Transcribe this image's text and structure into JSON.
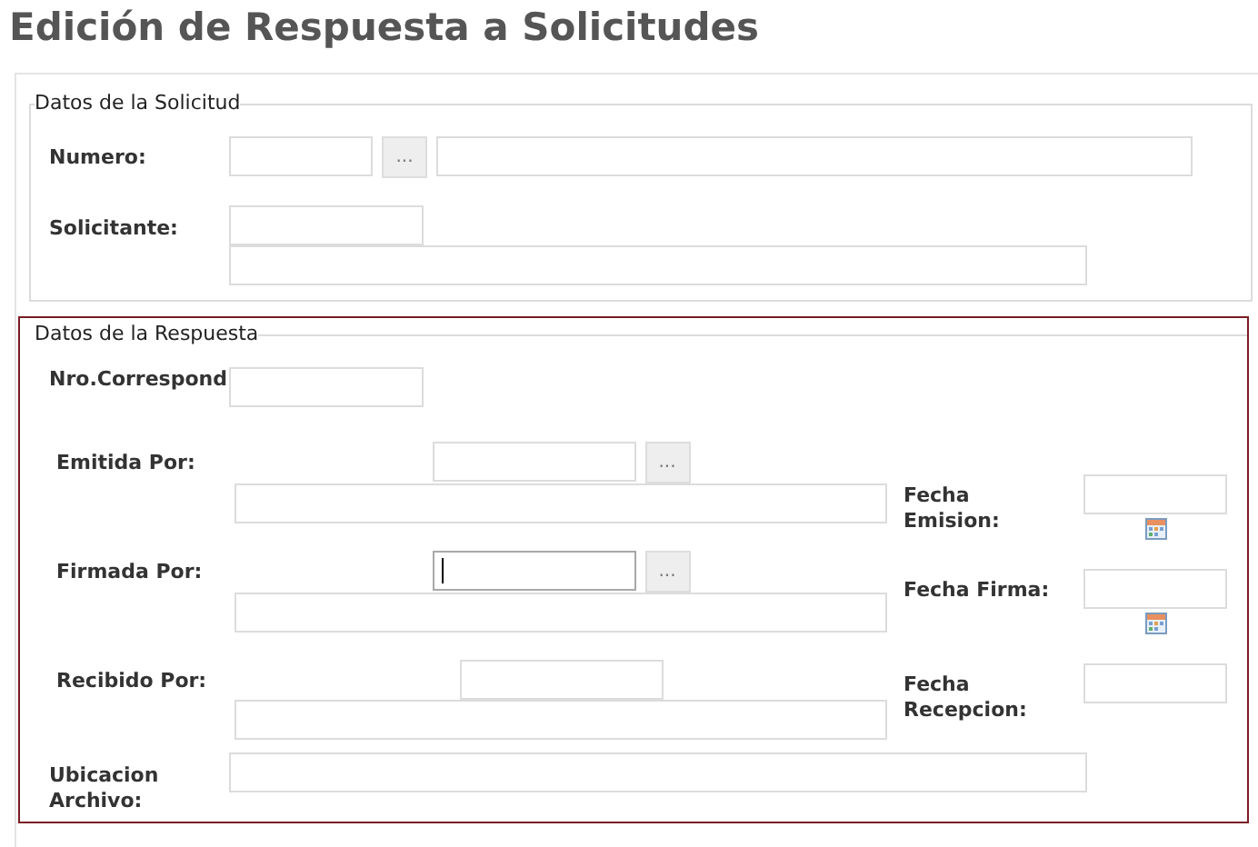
{
  "page_title": "Edición de Respuesta a Solicitudes",
  "solicitud": {
    "legend": "Datos de la Solicitud",
    "numero": {
      "label": "Numero:",
      "button": "..."
    },
    "solicitante": {
      "label": "Solicitante:"
    }
  },
  "respuesta": {
    "legend": "Datos de la Respuesta",
    "nro_correspond": {
      "label": "Nro.Correspond"
    },
    "persons": [
      {
        "label": "Emitida Por:",
        "button": "...",
        "focused": false
      },
      {
        "label": "Firmada Por:",
        "button": "...",
        "focused": true
      },
      {
        "label": "Recibido Por:",
        "focused": false
      }
    ],
    "dates": [
      {
        "label": "Fecha Emision:",
        "calendar": true
      },
      {
        "label": "Fecha Firma:",
        "calendar": true
      },
      {
        "label": "Fecha Recepcion:",
        "calendar": false
      }
    ],
    "ubicacion": {
      "label": "Ubicacion Archivo:"
    }
  }
}
